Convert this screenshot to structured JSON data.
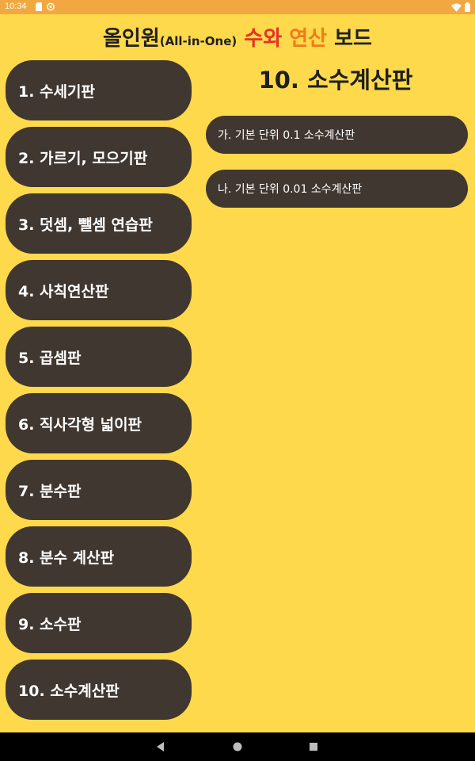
{
  "status_bar": {
    "time": "10:34",
    "color": "#F2A841",
    "left_icons": [
      "sd-card-icon",
      "cast-icon"
    ],
    "right_icons": [
      "wifi-icon",
      "battery-icon"
    ]
  },
  "app_title": {
    "part1": "올인원",
    "part2": "(All-in-One)",
    "part3": "수와",
    "part4": "연산",
    "part5": "보드"
  },
  "menu": {
    "items": [
      {
        "label": "1. 수세기판"
      },
      {
        "label": "2. 가르기, 모으기판"
      },
      {
        "label": "3. 덧셈, 뺄셈 연습판"
      },
      {
        "label": "4. 사칙연산판"
      },
      {
        "label": "5. 곱셈판"
      },
      {
        "label": "6. 직사각형 넓이판"
      },
      {
        "label": "7. 분수판"
      },
      {
        "label": "8. 분수 계산판"
      },
      {
        "label": "9. 소수판"
      },
      {
        "label": "10. 소수계산판"
      }
    ]
  },
  "content": {
    "title": "10. 소수계산판",
    "sub_items": [
      {
        "label": "가. 기본 단위 0.1 소수계산판"
      },
      {
        "label": "나. 기본 단위 0.01 소수계산판"
      }
    ]
  },
  "colors": {
    "background": "#FED94B",
    "button": "#403730",
    "accent_red": "#E53126",
    "accent_orange": "#F07A1A"
  },
  "nav_bar": {
    "buttons": [
      "back-icon",
      "home-icon",
      "recents-icon"
    ]
  }
}
